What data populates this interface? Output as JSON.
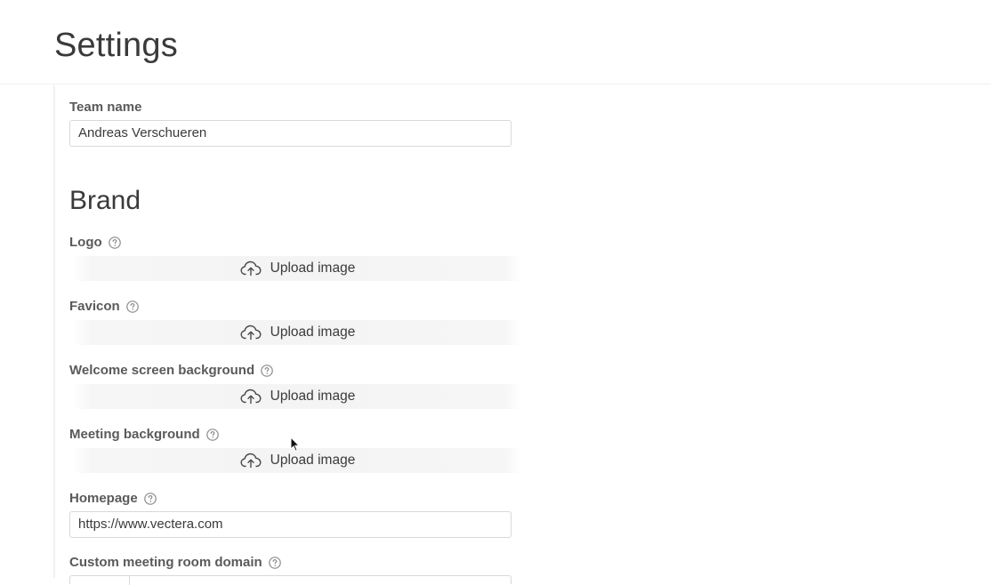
{
  "header": {
    "title": "Settings"
  },
  "team": {
    "label": "Team name",
    "value": "Andreas Verschueren"
  },
  "brand": {
    "section_title": "Brand",
    "fields": [
      {
        "label": "Logo",
        "upload_label": "Upload image",
        "help_icon": "question-circle-icon"
      },
      {
        "label": "Favicon",
        "upload_label": "Upload image",
        "help_icon": "question-circle-icon"
      },
      {
        "label": "Welcome screen background",
        "upload_label": "Upload image",
        "help_icon": "question-circle-icon"
      },
      {
        "label": "Meeting background",
        "upload_label": "Upload image",
        "help_icon": "question-circle-icon"
      }
    ]
  },
  "homepage": {
    "label": "Homepage",
    "value": "https://www.vectera.com"
  },
  "custom_domain": {
    "label": "Custom meeting room domain"
  },
  "colors": {
    "text": "#3a3a3a",
    "label": "#5a5a5a",
    "border": "#d9d9d9",
    "upload_bg": "#f4f4f4"
  }
}
